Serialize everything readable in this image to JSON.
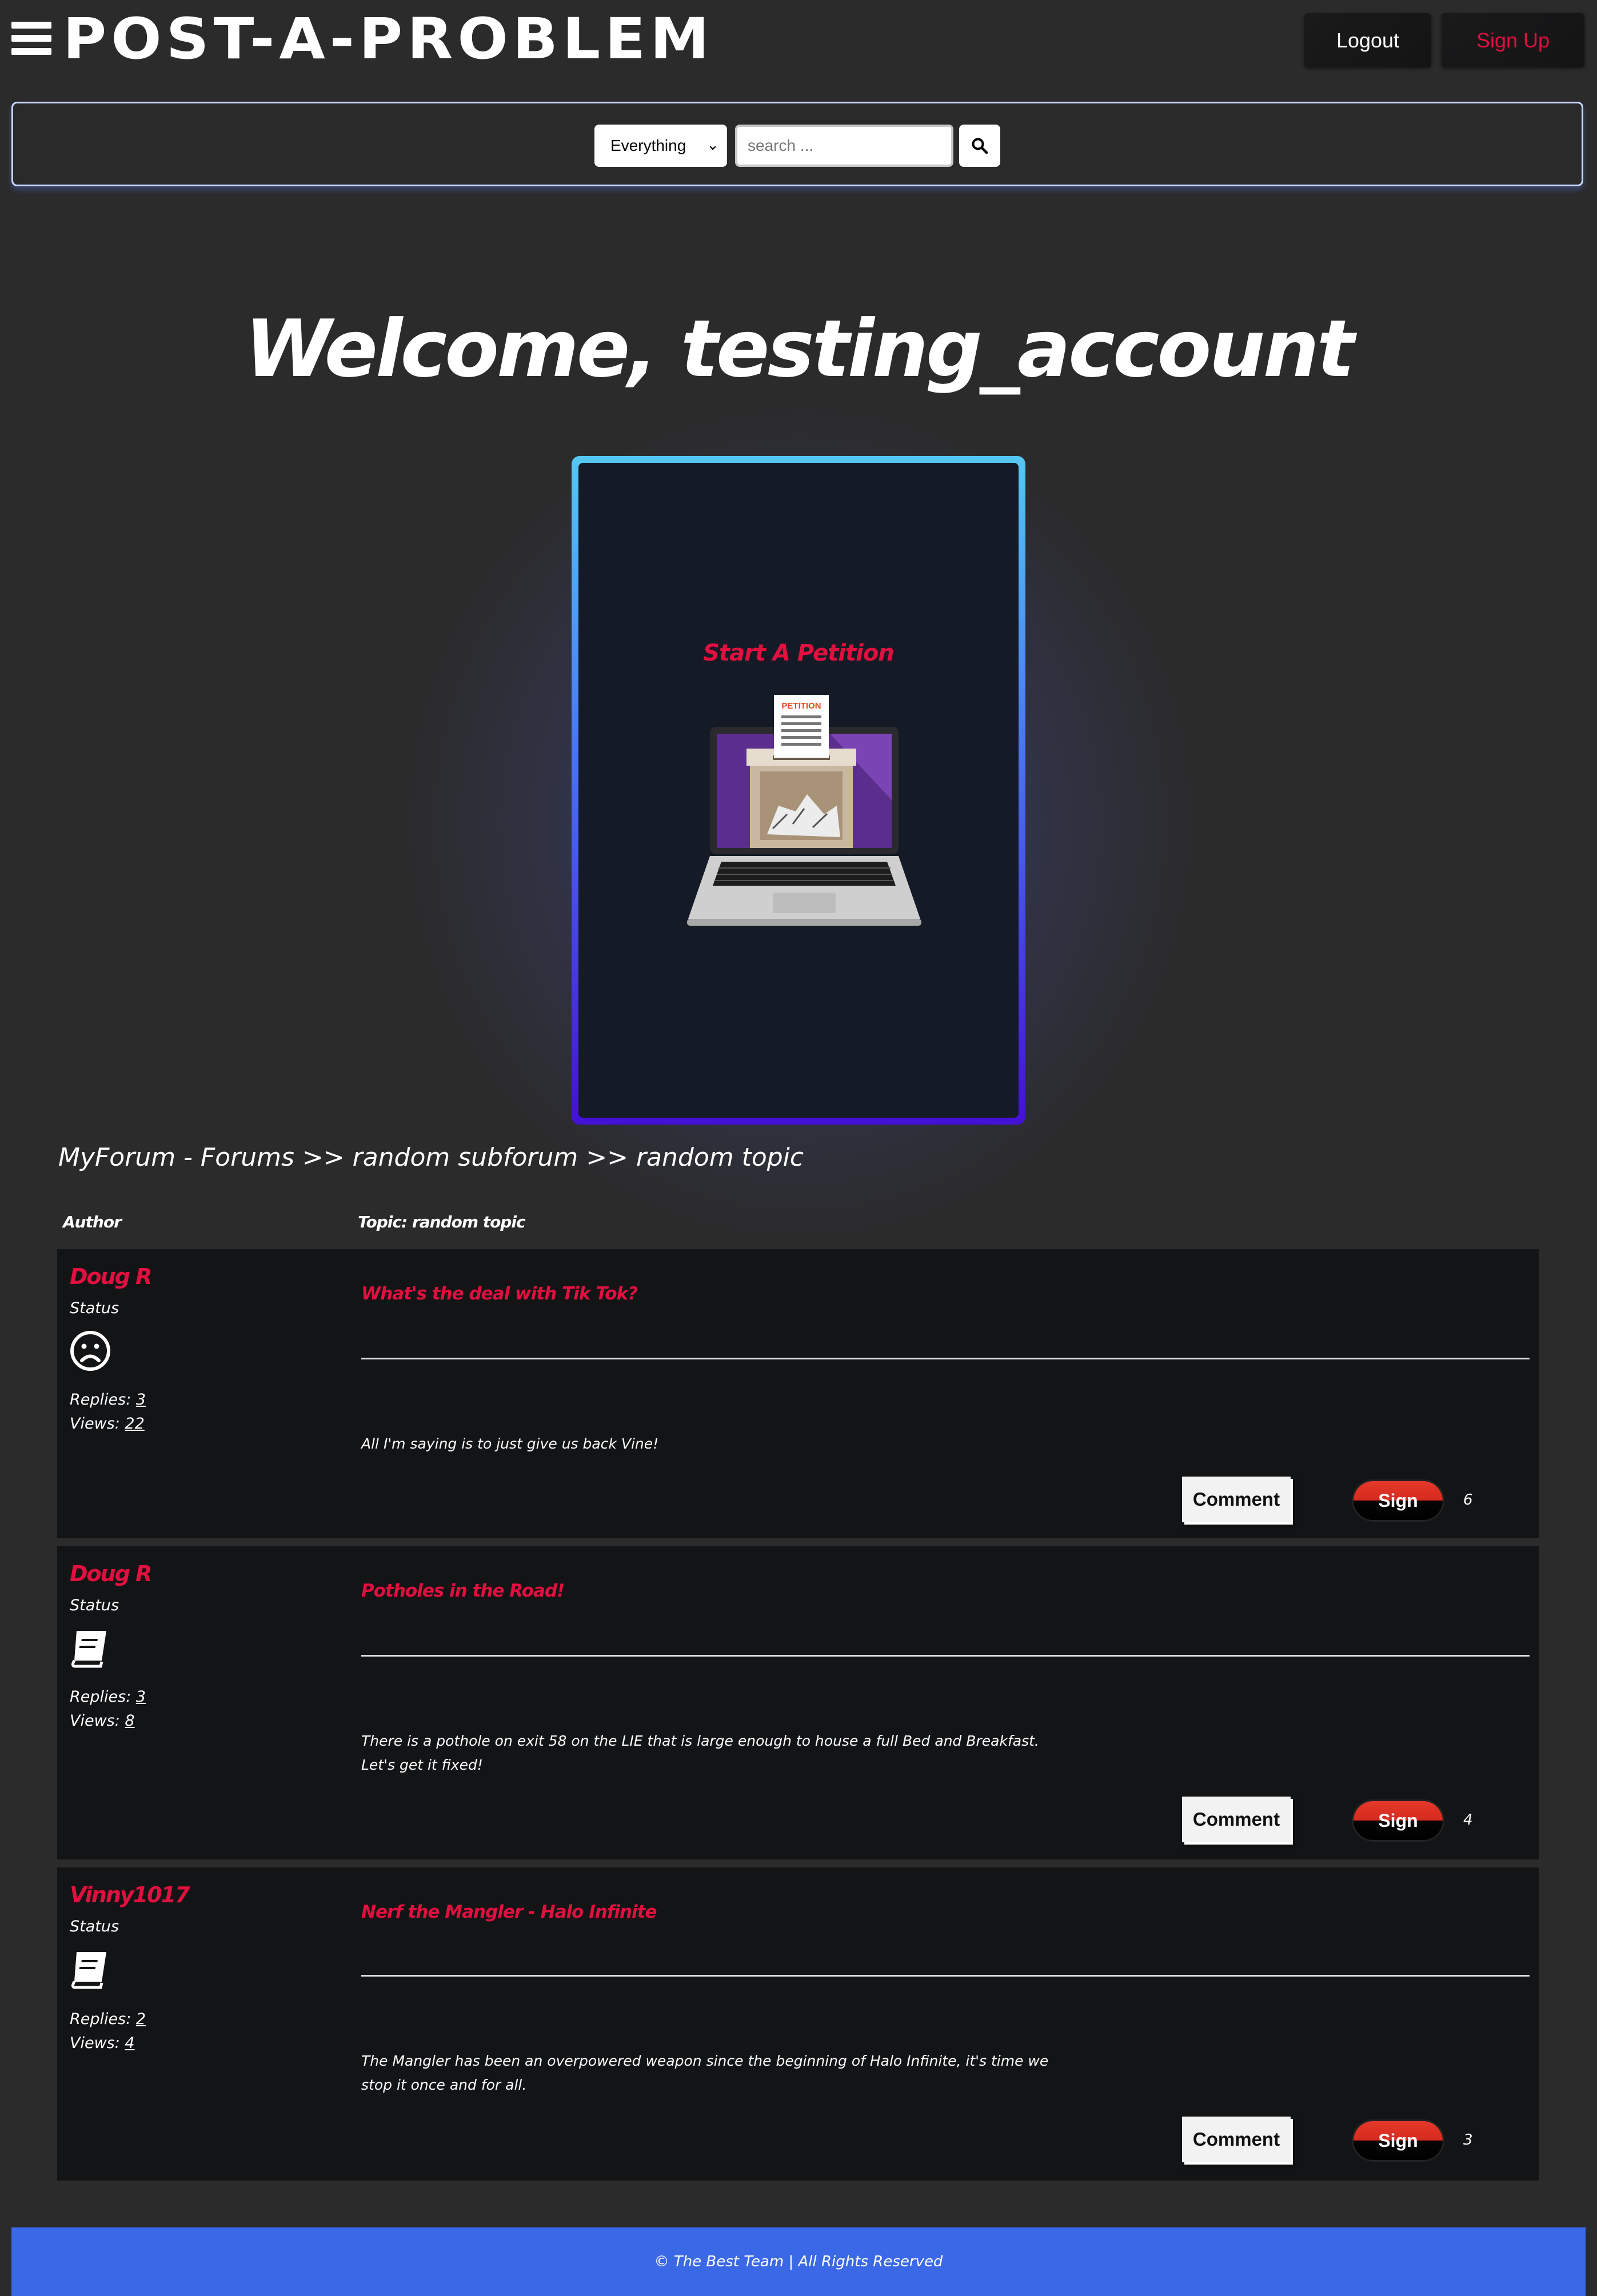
{
  "header": {
    "logo": "POST-A-PROBLEM",
    "logout_label": "Logout",
    "signup_label": "Sign Up"
  },
  "search": {
    "scope_selected": "Everything",
    "placeholder": "search ..."
  },
  "welcome": "Welcome, testing_account",
  "petition_card": {
    "title": "Start A Petition",
    "image_label": "PETITION"
  },
  "breadcrumb": "MyForum - Forums >> random subforum >> random topic",
  "table": {
    "author_header": "Author",
    "topic_header": "Topic: random topic"
  },
  "posts": [
    {
      "author": "Doug R",
      "status": "Status",
      "icon": "sad-face-icon",
      "replies_label": "Replies: ",
      "replies": "3",
      "views_label": "Views: ",
      "views": "22",
      "title": "What's the deal with Tik Tok?",
      "body": "All I'm saying is to just give us back Vine!",
      "comment_label": "Comment",
      "sign_label": "Sign",
      "signatures": "6"
    },
    {
      "author": "Doug R",
      "status": "Status",
      "icon": "book-icon",
      "replies_label": "Replies: ",
      "replies": "3",
      "views_label": "Views: ",
      "views": "8",
      "title": "Potholes in the Road!",
      "body": "There is a pothole on exit 58 on the LIE that is large enough to house a full Bed and Breakfast. Let's get it fixed!",
      "comment_label": "Comment",
      "sign_label": "Sign",
      "signatures": "4"
    },
    {
      "author": "Vinny1017",
      "status": "Status",
      "icon": "book-icon",
      "replies_label": "Replies: ",
      "replies": "2",
      "views_label": "Views: ",
      "views": "4",
      "title": "Nerf the Mangler - Halo Infinite",
      "body": "The Mangler has been an overpowered weapon since the beginning of Halo Infinite, it's time we stop it once and for all.",
      "comment_label": "Comment",
      "sign_label": "Sign",
      "signatures": "3"
    }
  ],
  "footer": "© The Best Team | All Rights Reserved",
  "colors": {
    "accent_red": "#e1103f",
    "footer_blue": "#3b68e6",
    "background": "#2b2b2c"
  }
}
